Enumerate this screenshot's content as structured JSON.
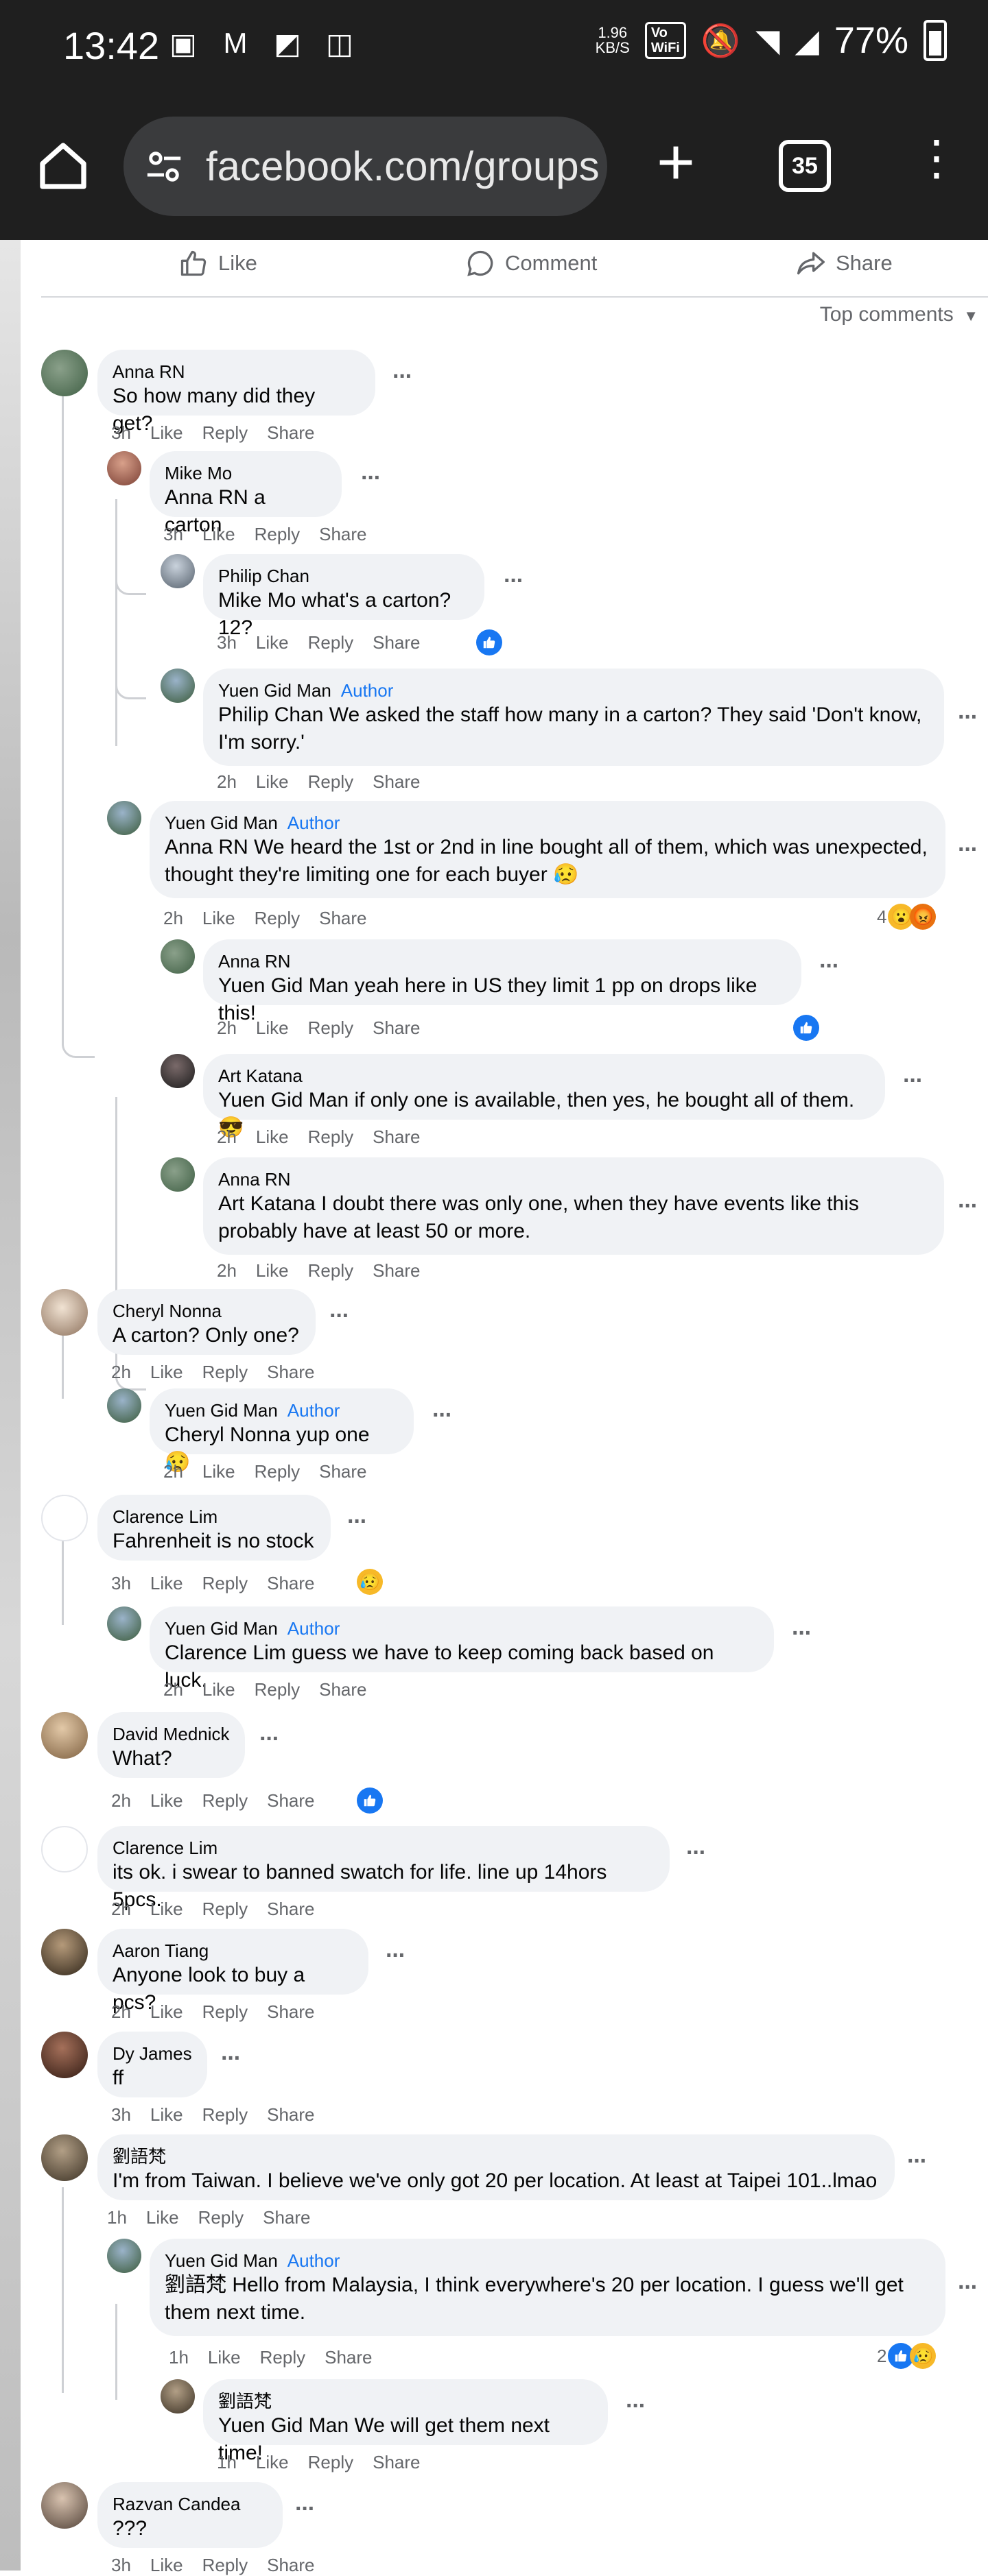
{
  "status_bar": {
    "time": "13:42",
    "speed_top": "1.96",
    "speed_bottom": "KB/S",
    "volte_top": "Vo",
    "volte_bottom": "WiFi",
    "battery": "77%"
  },
  "browser": {
    "url": "facebook.com/groups",
    "tab_count": "35"
  },
  "actions": {
    "like": "Like",
    "comment": "Comment",
    "share": "Share",
    "sort": "Top comments"
  },
  "meta_labels": {
    "like": "Like",
    "reply": "Reply",
    "share": "Share",
    "author": "Author"
  },
  "comments": [
    {
      "name": "Anna RN",
      "text": "So how many did they get?",
      "time": "3h"
    },
    {
      "name": "Mike Mo",
      "text": "Anna RN a carton",
      "time": "3h"
    },
    {
      "name": "Philip Chan",
      "text": "Mike Mo what's a carton? 12?",
      "time": "3h"
    },
    {
      "name": "Yuen Gid Man",
      "text_1": "Philip Chan We asked the staff how many in a carton? They said 'Don't know,",
      "text_2": "I'm sorry.'",
      "time": "2h"
    },
    {
      "name": "Yuen Gid Man",
      "text_1": "Anna RN We heard the 1st or 2nd in line bought all of them, which was unexpected,",
      "text_2": "thought they're limiting one for each buyer 😥",
      "time": "2h",
      "reactions": "4"
    },
    {
      "name": "Anna RN",
      "text": "Yuen Gid Man yeah here in US they limit 1 pp on drops like this!",
      "time": "2h"
    },
    {
      "name": "Art Katana",
      "text": "Yuen Gid Man if only one is available, then yes, he bought all of them. 😎",
      "time": "2h"
    },
    {
      "name": "Anna RN",
      "text_1": "Art Katana I doubt there was only one, when they have events like this",
      "text_2": "probably have at least 50 or more.",
      "time": "2h"
    },
    {
      "name": "Cheryl Nonna",
      "text": "A carton? Only one?",
      "time": "2h"
    },
    {
      "name": "Yuen Gid Man",
      "text": "Cheryl Nonna yup one 😥",
      "time": "2h"
    },
    {
      "name": "Clarence Lim",
      "text": "Fahrenheit is no stock",
      "time": "3h"
    },
    {
      "name": "Yuen Gid Man",
      "text": "Clarence Lim guess we have to keep coming back based on luck.",
      "time": "2h"
    },
    {
      "name": "David Mednick",
      "text": "What?",
      "time": "2h"
    },
    {
      "name": "Clarence Lim",
      "text": "its ok. i swear to banned swatch for life. line up 14hors 5pcs.",
      "time": "2h"
    },
    {
      "name": "Aaron Tiang",
      "text": "Anyone look to buy a pcs?",
      "time": "2h"
    },
    {
      "name": "Dy James",
      "text": "ff",
      "time": "3h"
    },
    {
      "name": "劉語梵",
      "text": "I'm from Taiwan. I believe we've only got 20 per location. At least at Taipei 101..lmao",
      "time": "1h"
    },
    {
      "name": "Yuen Gid Man",
      "text_1": "劉語梵 Hello from Malaysia, I think everywhere's 20 per location. I guess we'll get",
      "text_2": "them next time.",
      "time": "1h",
      "reactions": "2"
    },
    {
      "name": "劉語梵",
      "text": "Yuen Gid Man We will get them next time!",
      "time": "1h"
    },
    {
      "name": "Razvan Candea",
      "text": "???",
      "time": "3h"
    }
  ],
  "colors": {
    "accent": "#1877f2",
    "bubble": "#f0f2f5",
    "muted": "#65676b",
    "bar": "#1f1f1f"
  },
  "icons": [
    "home-icon",
    "tune-icon",
    "plus-icon",
    "tabs-icon",
    "more-icon",
    "like-icon",
    "comment-icon",
    "share-icon",
    "caret-down-icon",
    "ellipsis-icon"
  ]
}
